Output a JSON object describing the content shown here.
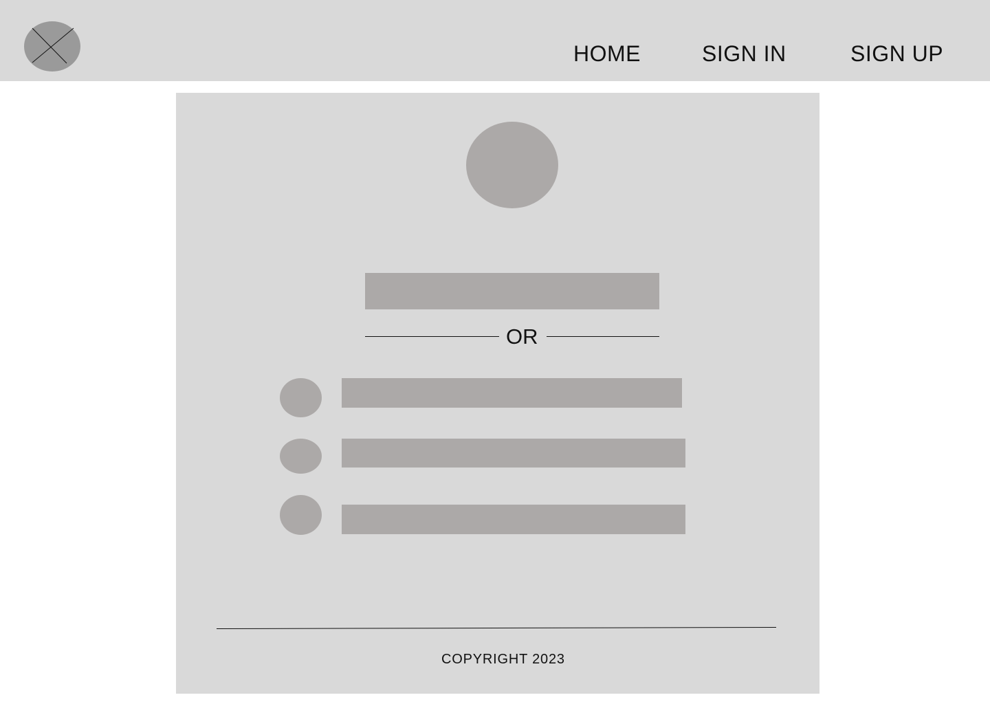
{
  "header": {
    "logo_icon": "placeholder-x-icon",
    "nav": {
      "home": "HOME",
      "sign_in": "SIGN IN",
      "sign_up": "SIGN UP"
    }
  },
  "card": {
    "avatar_icon": "avatar-placeholder-icon",
    "divider_text": "OR",
    "providers": [
      {
        "icon": "provider-icon"
      },
      {
        "icon": "provider-icon"
      },
      {
        "icon": "provider-icon"
      }
    ]
  },
  "footer": {
    "copyright": "COPYRIGHT 2023"
  },
  "colors": {
    "background": "#ffffff",
    "panel": "#d9d9d9",
    "placeholder": "#aca9a8",
    "logo": "#9a9a9a",
    "text": "#111111"
  }
}
